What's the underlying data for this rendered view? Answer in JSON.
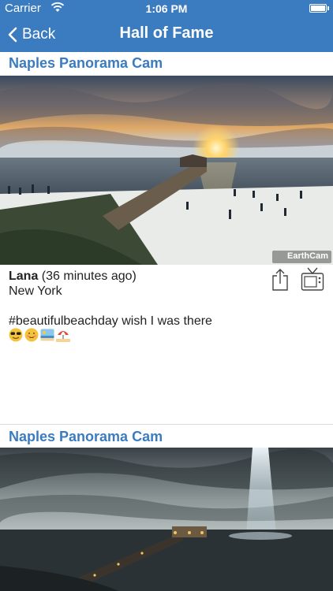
{
  "status_bar": {
    "carrier": "Carrier",
    "time": "1:06 PM"
  },
  "nav": {
    "back_label": "Back",
    "title": "Hall of Fame"
  },
  "posts": [
    {
      "cam_title": "Naples Panorama Cam",
      "watermark": "EarthCam",
      "user": "Lana",
      "time_ago": "(36 minutes ago)",
      "location": "New York",
      "comment": "#beautifulbeachday wish I was there",
      "emojis": [
        "sunglasses-face",
        "smiling-face",
        "beach-picture",
        "beach-umbrella"
      ]
    },
    {
      "cam_title": "Naples Panorama Cam"
    }
  ],
  "colors": {
    "accent": "#3b7cc0"
  }
}
